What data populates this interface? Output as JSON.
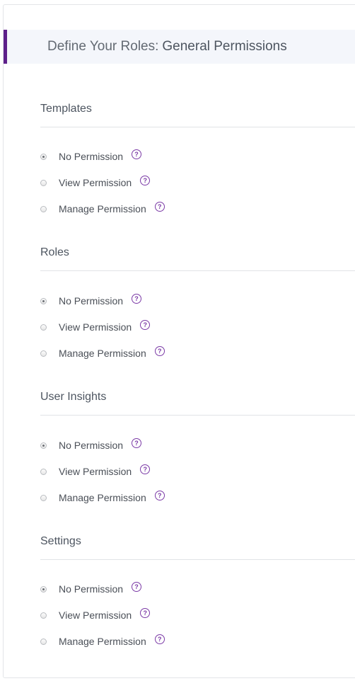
{
  "header": {
    "prefix": "Define Your Roles:",
    "title": "General Permissions"
  },
  "help_glyph": "?",
  "sections": [
    {
      "title": "Templates",
      "options": [
        {
          "label": "No Permission",
          "checked": true
        },
        {
          "label": "View Permission",
          "checked": false
        },
        {
          "label": "Manage Permission",
          "checked": false
        }
      ]
    },
    {
      "title": "Roles",
      "options": [
        {
          "label": "No Permission",
          "checked": true
        },
        {
          "label": "View Permission",
          "checked": false
        },
        {
          "label": "Manage Permission",
          "checked": false
        }
      ]
    },
    {
      "title": "User Insights",
      "options": [
        {
          "label": "No Permission",
          "checked": true
        },
        {
          "label": "View Permission",
          "checked": false
        },
        {
          "label": "Manage Permission",
          "checked": false
        }
      ]
    },
    {
      "title": "Settings",
      "options": [
        {
          "label": "No Permission",
          "checked": true
        },
        {
          "label": "View Permission",
          "checked": false
        },
        {
          "label": "Manage Permission",
          "checked": false
        }
      ]
    }
  ],
  "colors": {
    "accent": "#5d1f8a",
    "help_icon": "#7b3aa6",
    "header_bg": "#f4f6fb"
  }
}
